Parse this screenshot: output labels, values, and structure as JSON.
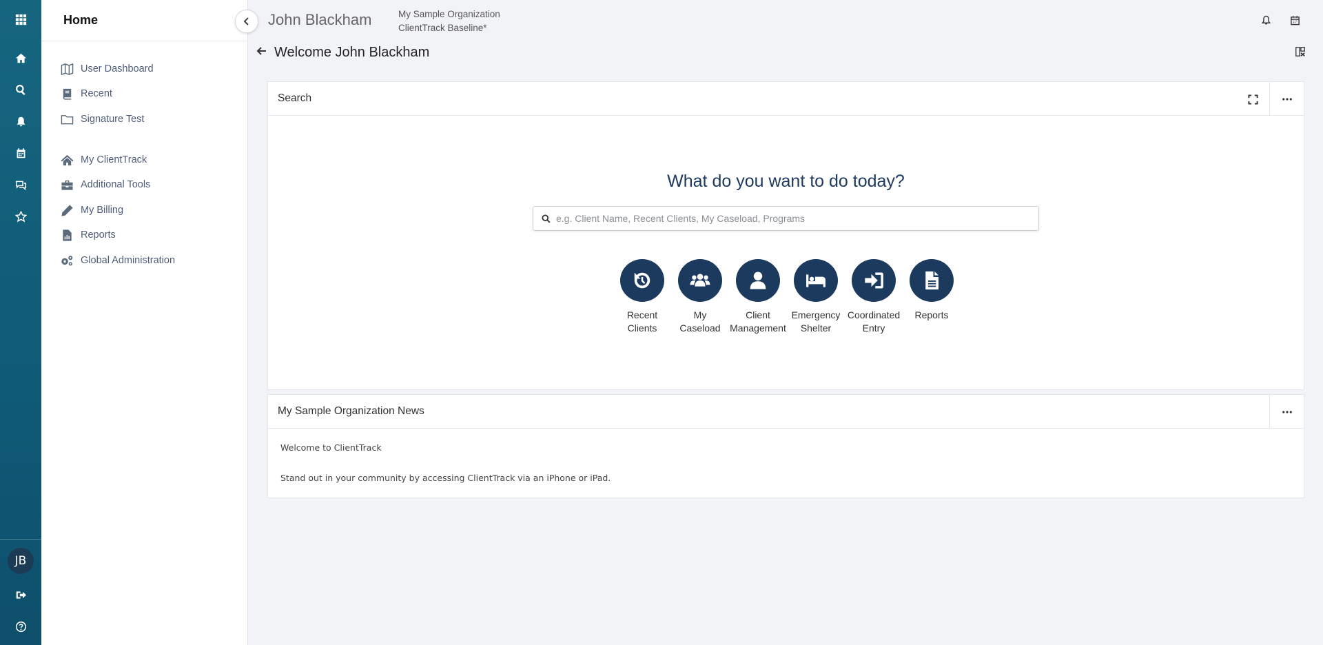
{
  "rail": {
    "icons": [
      "apps-grid-icon",
      "home-icon",
      "search-icon",
      "bell-icon",
      "calendar-icon",
      "chat-icon",
      "star-icon",
      "logout-icon",
      "help-icon"
    ],
    "avatar_initials": "JB"
  },
  "sidebar": {
    "title": "Home",
    "groups": [
      {
        "items": [
          {
            "label": "User Dashboard",
            "icon": "map-icon"
          },
          {
            "label": "Recent",
            "icon": "book-icon"
          },
          {
            "label": "Signature Test",
            "icon": "folder-icon"
          }
        ]
      },
      {
        "items": [
          {
            "label": "My ClientTrack",
            "icon": "home-icon"
          },
          {
            "label": "Additional Tools",
            "icon": "toolbox-icon"
          },
          {
            "label": "My Billing",
            "icon": "pencil-icon"
          },
          {
            "label": "Reports",
            "icon": "report-icon"
          },
          {
            "label": "Global Administration",
            "icon": "gears-icon"
          }
        ]
      }
    ]
  },
  "header": {
    "user_name": "John Blackham",
    "org_name": "My Sample Organization",
    "workgroup": "ClientTrack Baseline*"
  },
  "page": {
    "title": "Welcome John Blackham"
  },
  "search_panel": {
    "title": "Search",
    "question": "What do you want to do today?",
    "search_placeholder": "e.g. Client Name, Recent Clients, My Caseload, Programs",
    "search_value": "",
    "tiles": [
      {
        "line1": "Recent",
        "line2": "Clients",
        "icon": "history-icon"
      },
      {
        "line1": "My",
        "line2": "Caseload",
        "icon": "users-icon"
      },
      {
        "line1": "Client",
        "line2": "Management",
        "icon": "user-icon"
      },
      {
        "line1": "Emergency",
        "line2": "Shelter",
        "icon": "bed-icon"
      },
      {
        "line1": "Coordinated",
        "line2": "Entry",
        "icon": "sign-in-icon"
      },
      {
        "line1": "Reports",
        "line2": "",
        "icon": "document-icon"
      }
    ]
  },
  "news_panel": {
    "title": "My Sample Organization News",
    "lines": [
      "Welcome to ClientTrack",
      "Stand out in your community by accessing ClientTrack via an iPhone or iPad."
    ]
  },
  "colors": {
    "rail": "#0f5a77",
    "tile": "#1c3a5e",
    "heading": "#1f3a60"
  }
}
